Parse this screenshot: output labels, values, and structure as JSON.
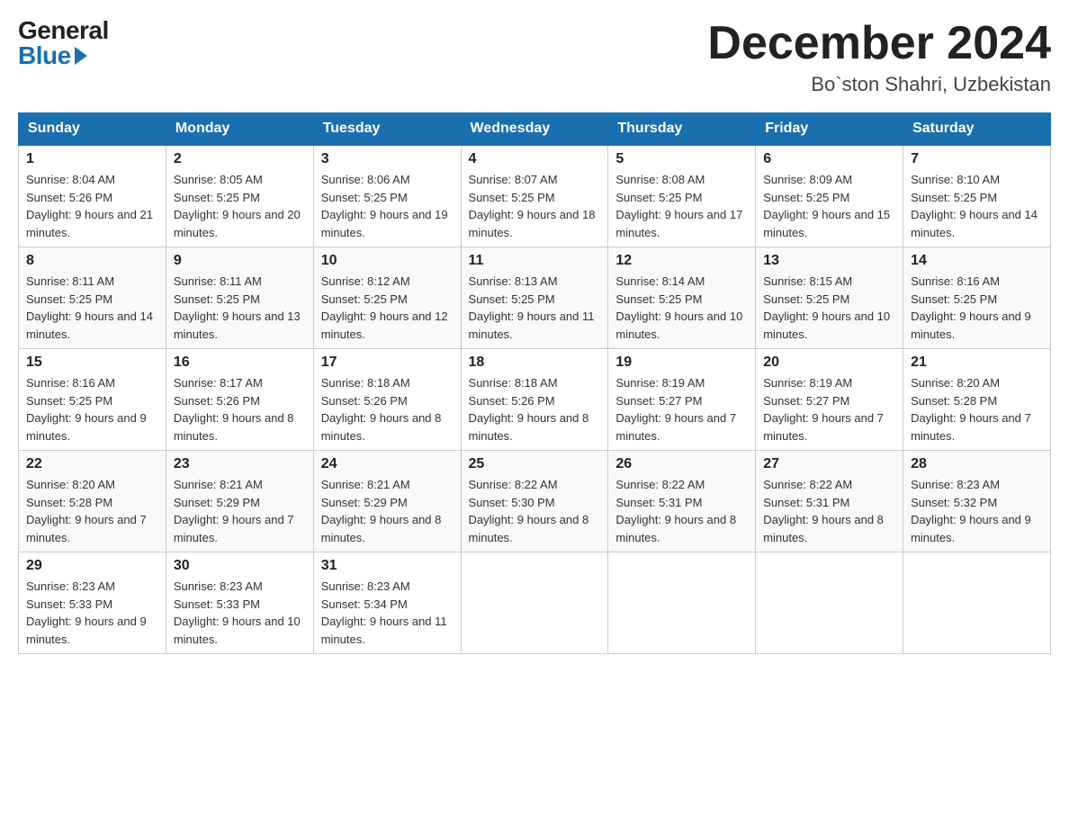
{
  "logo": {
    "general": "General",
    "blue": "Blue"
  },
  "header": {
    "month": "December 2024",
    "location": "Bo`ston Shahri, Uzbekistan"
  },
  "weekdays": [
    "Sunday",
    "Monday",
    "Tuesday",
    "Wednesday",
    "Thursday",
    "Friday",
    "Saturday"
  ],
  "weeks": [
    [
      {
        "day": "1",
        "sunrise": "8:04 AM",
        "sunset": "5:26 PM",
        "daylight": "9 hours and 21 minutes."
      },
      {
        "day": "2",
        "sunrise": "8:05 AM",
        "sunset": "5:25 PM",
        "daylight": "9 hours and 20 minutes."
      },
      {
        "day": "3",
        "sunrise": "8:06 AM",
        "sunset": "5:25 PM",
        "daylight": "9 hours and 19 minutes."
      },
      {
        "day": "4",
        "sunrise": "8:07 AM",
        "sunset": "5:25 PM",
        "daylight": "9 hours and 18 minutes."
      },
      {
        "day": "5",
        "sunrise": "8:08 AM",
        "sunset": "5:25 PM",
        "daylight": "9 hours and 17 minutes."
      },
      {
        "day": "6",
        "sunrise": "8:09 AM",
        "sunset": "5:25 PM",
        "daylight": "9 hours and 15 minutes."
      },
      {
        "day": "7",
        "sunrise": "8:10 AM",
        "sunset": "5:25 PM",
        "daylight": "9 hours and 14 minutes."
      }
    ],
    [
      {
        "day": "8",
        "sunrise": "8:11 AM",
        "sunset": "5:25 PM",
        "daylight": "9 hours and 14 minutes."
      },
      {
        "day": "9",
        "sunrise": "8:11 AM",
        "sunset": "5:25 PM",
        "daylight": "9 hours and 13 minutes."
      },
      {
        "day": "10",
        "sunrise": "8:12 AM",
        "sunset": "5:25 PM",
        "daylight": "9 hours and 12 minutes."
      },
      {
        "day": "11",
        "sunrise": "8:13 AM",
        "sunset": "5:25 PM",
        "daylight": "9 hours and 11 minutes."
      },
      {
        "day": "12",
        "sunrise": "8:14 AM",
        "sunset": "5:25 PM",
        "daylight": "9 hours and 10 minutes."
      },
      {
        "day": "13",
        "sunrise": "8:15 AM",
        "sunset": "5:25 PM",
        "daylight": "9 hours and 10 minutes."
      },
      {
        "day": "14",
        "sunrise": "8:16 AM",
        "sunset": "5:25 PM",
        "daylight": "9 hours and 9 minutes."
      }
    ],
    [
      {
        "day": "15",
        "sunrise": "8:16 AM",
        "sunset": "5:25 PM",
        "daylight": "9 hours and 9 minutes."
      },
      {
        "day": "16",
        "sunrise": "8:17 AM",
        "sunset": "5:26 PM",
        "daylight": "9 hours and 8 minutes."
      },
      {
        "day": "17",
        "sunrise": "8:18 AM",
        "sunset": "5:26 PM",
        "daylight": "9 hours and 8 minutes."
      },
      {
        "day": "18",
        "sunrise": "8:18 AM",
        "sunset": "5:26 PM",
        "daylight": "9 hours and 8 minutes."
      },
      {
        "day": "19",
        "sunrise": "8:19 AM",
        "sunset": "5:27 PM",
        "daylight": "9 hours and 7 minutes."
      },
      {
        "day": "20",
        "sunrise": "8:19 AM",
        "sunset": "5:27 PM",
        "daylight": "9 hours and 7 minutes."
      },
      {
        "day": "21",
        "sunrise": "8:20 AM",
        "sunset": "5:28 PM",
        "daylight": "9 hours and 7 minutes."
      }
    ],
    [
      {
        "day": "22",
        "sunrise": "8:20 AM",
        "sunset": "5:28 PM",
        "daylight": "9 hours and 7 minutes."
      },
      {
        "day": "23",
        "sunrise": "8:21 AM",
        "sunset": "5:29 PM",
        "daylight": "9 hours and 7 minutes."
      },
      {
        "day": "24",
        "sunrise": "8:21 AM",
        "sunset": "5:29 PM",
        "daylight": "9 hours and 8 minutes."
      },
      {
        "day": "25",
        "sunrise": "8:22 AM",
        "sunset": "5:30 PM",
        "daylight": "9 hours and 8 minutes."
      },
      {
        "day": "26",
        "sunrise": "8:22 AM",
        "sunset": "5:31 PM",
        "daylight": "9 hours and 8 minutes."
      },
      {
        "day": "27",
        "sunrise": "8:22 AM",
        "sunset": "5:31 PM",
        "daylight": "9 hours and 8 minutes."
      },
      {
        "day": "28",
        "sunrise": "8:23 AM",
        "sunset": "5:32 PM",
        "daylight": "9 hours and 9 minutes."
      }
    ],
    [
      {
        "day": "29",
        "sunrise": "8:23 AM",
        "sunset": "5:33 PM",
        "daylight": "9 hours and 9 minutes."
      },
      {
        "day": "30",
        "sunrise": "8:23 AM",
        "sunset": "5:33 PM",
        "daylight": "9 hours and 10 minutes."
      },
      {
        "day": "31",
        "sunrise": "8:23 AM",
        "sunset": "5:34 PM",
        "daylight": "9 hours and 11 minutes."
      },
      null,
      null,
      null,
      null
    ]
  ]
}
